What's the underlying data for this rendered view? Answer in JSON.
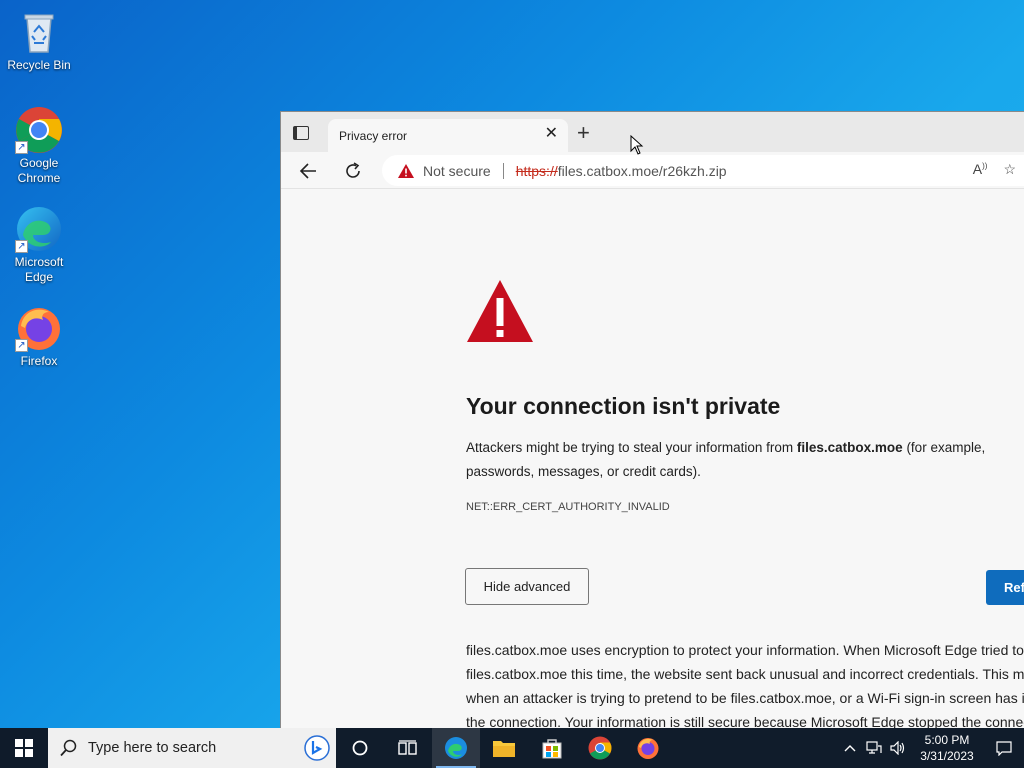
{
  "desktop": {
    "icons": [
      {
        "label": "Recycle Bin"
      },
      {
        "label": "Google Chrome"
      },
      {
        "label": "Microsoft Edge"
      },
      {
        "label": "Firefox"
      }
    ]
  },
  "browser": {
    "tab": {
      "title": "Privacy error",
      "close": "✕"
    },
    "new_tab": "+",
    "address": {
      "security_label": "Not secure",
      "url_scheme": "https://",
      "url_rest": "files.catbox.moe/r26kzh.zip"
    },
    "page": {
      "title": "Your connection isn't private",
      "desc_before": "Attackers might be trying to steal your information from ",
      "desc_host": "files.catbox.moe",
      "desc_after": " (for example, passwords, messages, or credit cards).",
      "error_code": "NET::ERR_CERT_AUTHORITY_INVALID",
      "hide_advanced": "Hide advanced",
      "refresh": "Refresh",
      "advanced_text": "files.catbox.moe uses encryption to protect your information. When Microsoft Edge tried to connect to files.catbox.moe this time, the website sent back unusual and incorrect credentials. This may happen when an attacker is trying to pretend to be files.catbox.moe, or a Wi-Fi sign-in screen has interrupted the connection. Your information is still secure because Microsoft Edge stopped the connection before any data was exchanged."
    }
  },
  "taskbar": {
    "search_placeholder": "Type here to search",
    "clock_time": "5:00 PM",
    "clock_date": "3/31/2023"
  },
  "colors": {
    "accent": "#0f6cbd",
    "warning_red": "#c50f1f"
  }
}
